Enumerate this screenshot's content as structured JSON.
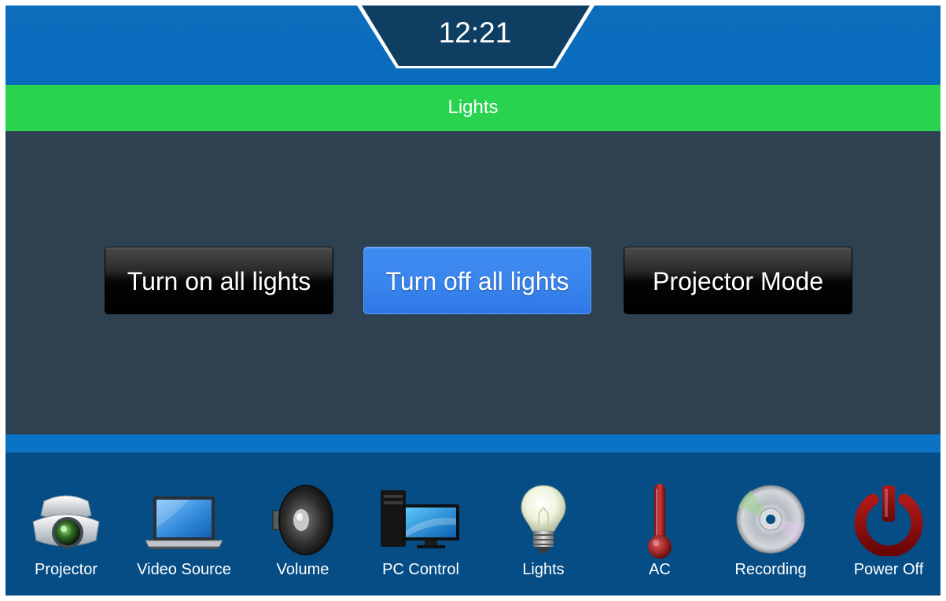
{
  "header": {
    "clock": "12:21"
  },
  "page": {
    "title": "Lights"
  },
  "actions": [
    {
      "label": "Turn on all lights",
      "state": "default"
    },
    {
      "label": "Turn off all lights",
      "state": "active"
    },
    {
      "label": "Projector Mode",
      "state": "default"
    }
  ],
  "dock": [
    {
      "label": "Projector",
      "icon": "projector-icon"
    },
    {
      "label": "Video Source",
      "icon": "laptop-icon"
    },
    {
      "label": "Volume",
      "icon": "speaker-icon"
    },
    {
      "label": "PC Control",
      "icon": "desktop-pc-icon"
    },
    {
      "label": "Lights",
      "icon": "lightbulb-icon"
    },
    {
      "label": "AC",
      "icon": "thermometer-icon"
    },
    {
      "label": "Recording",
      "icon": "disc-icon"
    },
    {
      "label": "Power Off",
      "icon": "power-icon"
    }
  ],
  "colors": {
    "header": "#0a6cbd",
    "title_bar": "#29d350",
    "content": "#2e4150",
    "active_button": "#3a86ef",
    "dock": "#054d84"
  }
}
